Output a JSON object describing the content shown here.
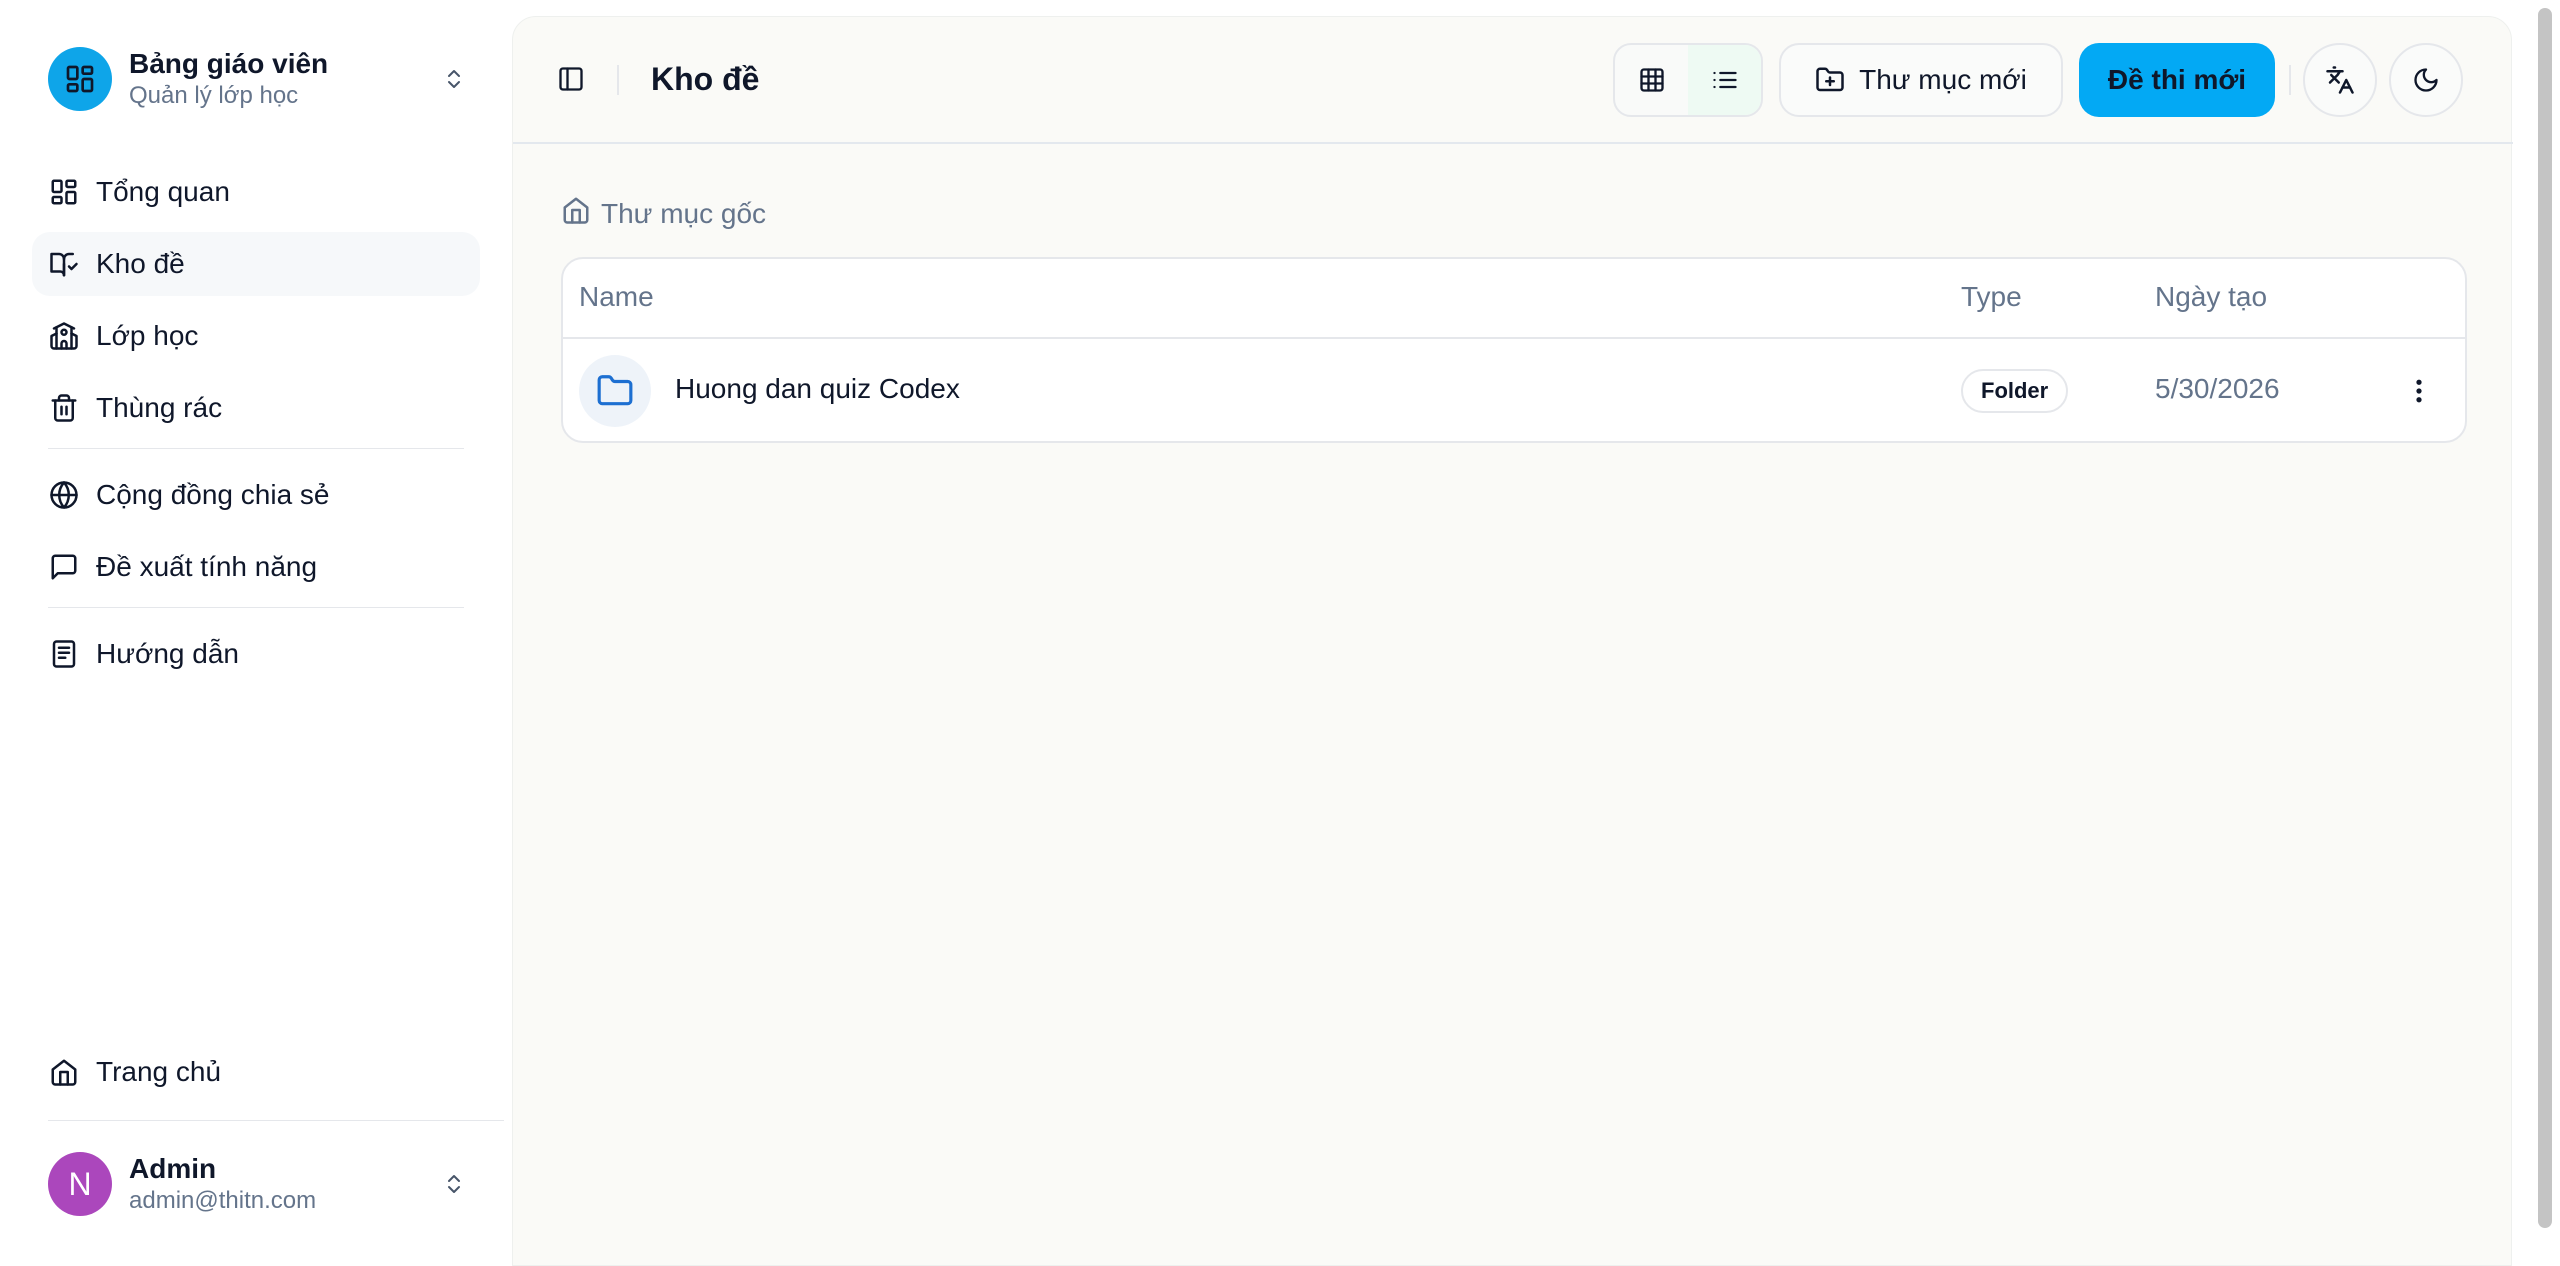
{
  "sidebar": {
    "brand": {
      "title": "Bảng giáo viên",
      "subtitle": "Quản lý lớp học"
    },
    "items": [
      {
        "label": "Tổng quan",
        "icon": "dashboard-icon"
      },
      {
        "label": "Kho đề",
        "icon": "book-check-icon",
        "active": true
      },
      {
        "label": "Lớp học",
        "icon": "school-icon"
      },
      {
        "label": "Thùng rác",
        "icon": "trash-icon"
      },
      {
        "label": "Cộng đồng chia sẻ",
        "icon": "globe-icon"
      },
      {
        "label": "Đề xuất tính năng",
        "icon": "message-square-icon"
      },
      {
        "label": "Hướng dẫn",
        "icon": "notebook-icon"
      }
    ],
    "bottom": {
      "label": "Trang chủ",
      "icon": "home-icon"
    },
    "user": {
      "initial": "N",
      "name": "Admin",
      "email": "admin@thitn.com"
    }
  },
  "header": {
    "title": "Kho đề",
    "new_folder_label": "Thư mục mới",
    "new_exam_label": "Đề thi mới"
  },
  "breadcrumb": {
    "root": "Thư mục gốc"
  },
  "table": {
    "columns": {
      "name": "Name",
      "type": "Type",
      "date": "Ngày tạo"
    },
    "rows": [
      {
        "name": "Huong dan quiz Codex",
        "type": "Folder",
        "date": "5/30/2026"
      }
    ]
  },
  "colors": {
    "accent": "#03a9f4",
    "avatar": "#ab47bc"
  }
}
